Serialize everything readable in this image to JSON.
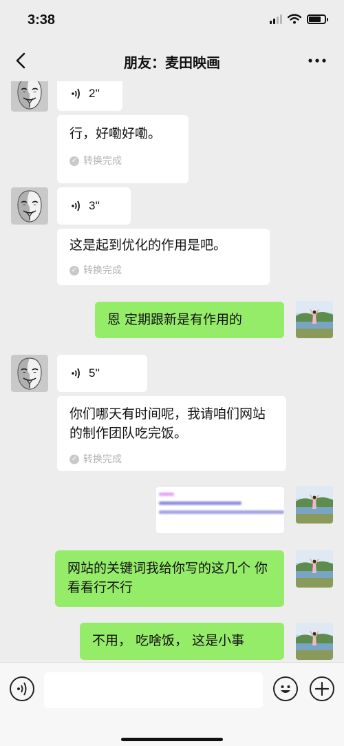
{
  "status_bar": {
    "time": "3:38"
  },
  "nav": {
    "title": "朋友：麦田映画"
  },
  "messages": [
    {
      "voice_duration": "2''",
      "transcript": "行，好嘞好嘞。",
      "status": "转换完成"
    },
    {
      "voice_duration": "3''",
      "transcript": "这是起到优化的作用是吧。",
      "status": "转换完成"
    },
    {
      "text": "恩 定期跟新是有作用的"
    },
    {
      "voice_duration": "5''",
      "transcript": "你们哪天有时间呢，我请咱们网站的制作团队吃完饭。",
      "status": "转换完成"
    },
    {
      "text": "网站的关键词我给你写的这几个 你看看行不行"
    },
    {
      "text": "不用， 吃啥饭， 这是小事"
    }
  ],
  "colors": {
    "outgoing_bubble": "#95ec69",
    "incoming_bubble": "#ffffff",
    "background": "#ededed"
  }
}
